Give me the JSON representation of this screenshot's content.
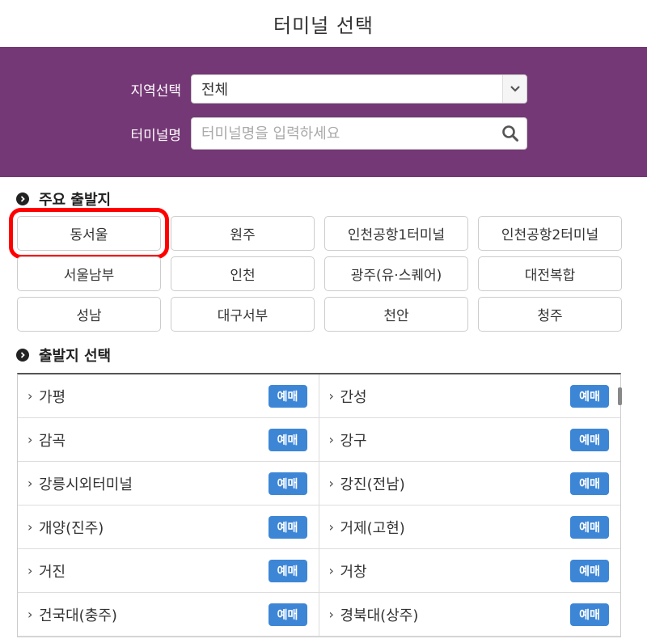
{
  "header": {
    "title": "터미널 선택"
  },
  "filter": {
    "region_label": "지역선택",
    "region_value": "전체",
    "terminal_label": "터미널명",
    "terminal_placeholder": "터미널명을 입력하세요"
  },
  "major": {
    "heading": "주요 출발지",
    "items": [
      "동서울",
      "원주",
      "인천공항1터미널",
      "인천공항2터미널",
      "서울남부",
      "인천",
      "광주(유·스퀘어)",
      "대전복합",
      "성남",
      "대구서부",
      "천안",
      "청주"
    ]
  },
  "departure": {
    "heading": "출발지 선택",
    "reserve_label": "예매",
    "rows": [
      [
        "가평",
        "간성"
      ],
      [
        "감곡",
        "강구"
      ],
      [
        "강릉시외터미널",
        "강진(전남)"
      ],
      [
        "개양(진주)",
        "거제(고현)"
      ],
      [
        "거진",
        "거창"
      ],
      [
        "건국대(충주)",
        "경북대(상주)"
      ]
    ]
  },
  "colors": {
    "panel": "#753876",
    "reserve": "#3d86d6",
    "highlight": "#ff0000"
  }
}
